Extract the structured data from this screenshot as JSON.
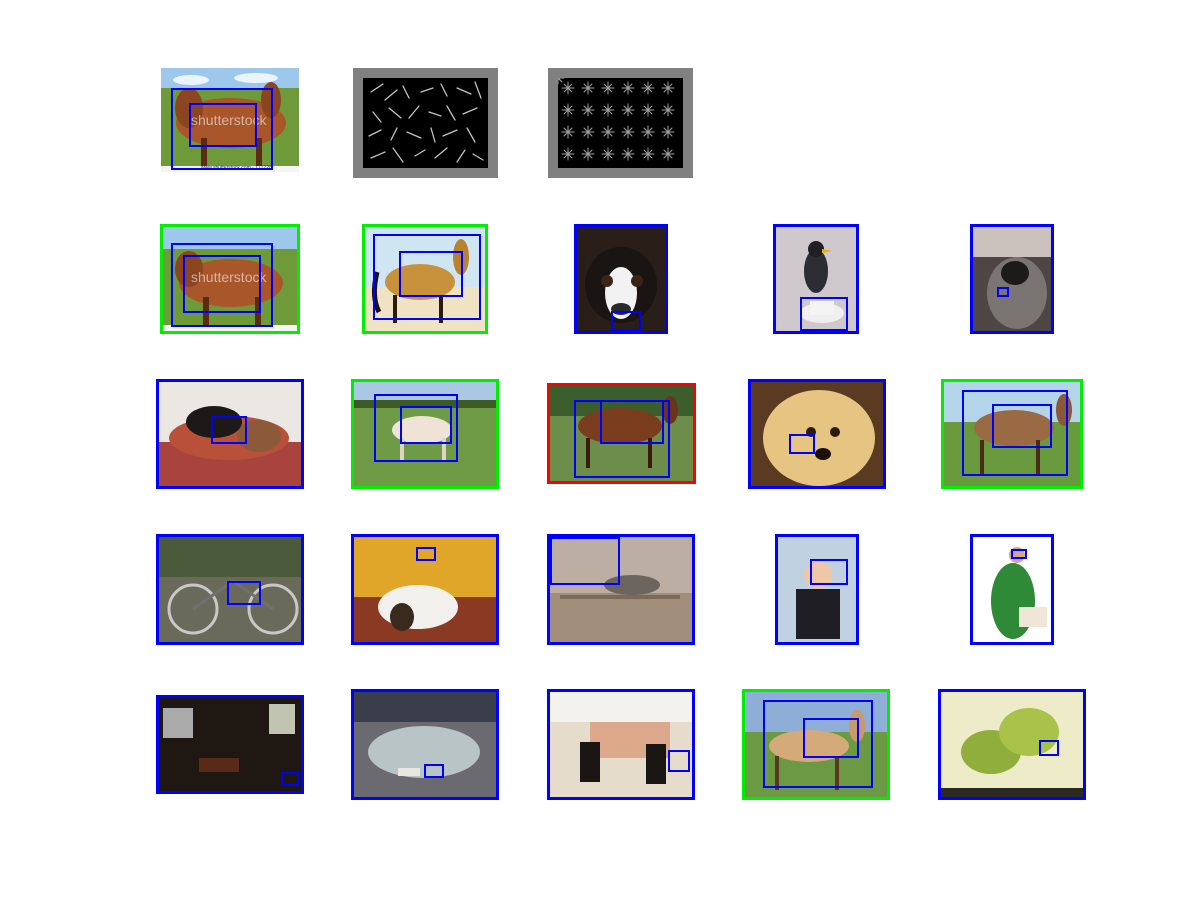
{
  "grid": {
    "rows": 5,
    "query": {
      "watermark": "shutterstock",
      "caption": "www.shutterstock.com · 177228"
    },
    "hog_panels": [
      "hog-positive-weights",
      "hog-negative-weights"
    ],
    "results": [
      {
        "subject": "horse (query copy)",
        "frame_color": "green",
        "watermark": "shutterstock"
      },
      {
        "subject": "horse",
        "frame_color": "green"
      },
      {
        "subject": "dog",
        "frame_color": "blue"
      },
      {
        "subject": "bird",
        "frame_color": "blue"
      },
      {
        "subject": "cat",
        "frame_color": "blue"
      },
      {
        "subject": "cat and dog",
        "frame_color": "blue"
      },
      {
        "subject": "horse",
        "frame_color": "green"
      },
      {
        "subject": "horse",
        "frame_color": "red"
      },
      {
        "subject": "dog",
        "frame_color": "blue"
      },
      {
        "subject": "horse",
        "frame_color": "green"
      },
      {
        "subject": "bicycle",
        "frame_color": "blue"
      },
      {
        "subject": "dog",
        "frame_color": "blue"
      },
      {
        "subject": "cat",
        "frame_color": "blue"
      },
      {
        "subject": "child",
        "frame_color": "blue"
      },
      {
        "subject": "person",
        "frame_color": "blue"
      },
      {
        "subject": "living room",
        "frame_color": "blue"
      },
      {
        "subject": "car",
        "frame_color": "blue"
      },
      {
        "subject": "dining table",
        "frame_color": "blue"
      },
      {
        "subject": "horse",
        "frame_color": "green"
      },
      {
        "subject": "plant",
        "frame_color": "blue"
      }
    ]
  },
  "colors": {
    "correct": "#00ee00",
    "incorrect": "#ff0000",
    "other": "#0000ff",
    "detection": "#0000ff",
    "hog_background": "#808080"
  }
}
